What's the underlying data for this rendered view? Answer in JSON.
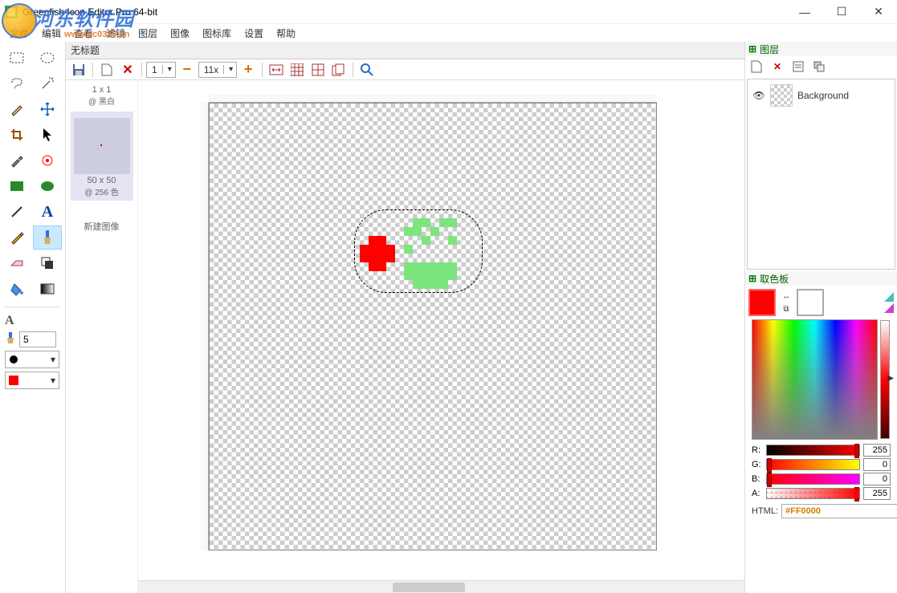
{
  "window": {
    "title": "Greenfish Icon Editor Pro 64-bit",
    "minimize": "—",
    "maximize": "☐",
    "close": "✕"
  },
  "menu": {
    "file": "文件",
    "edit": "编辑",
    "view": "查看",
    "filter": "滤镜",
    "layer": "图层",
    "image": "图像",
    "library": "图标库",
    "settings": "设置",
    "help": "帮助"
  },
  "doc_tab": "无标题",
  "toolbar": {
    "page_num": "1",
    "zoom": "11x"
  },
  "preview": {
    "size1": "1 x 1",
    "mode1": "@ 黑白",
    "size2": "50 x 50",
    "mode2": "@ 256 色",
    "new_image": "新建图像"
  },
  "brush_size": "5",
  "layers_panel": {
    "title": "图层",
    "layer0": "Background"
  },
  "palette_panel": {
    "title": "取色板"
  },
  "colors": {
    "fg": "#FF0000",
    "bg": "#FFFFFF"
  },
  "rgba": {
    "r_label": "R:",
    "r": "255",
    "g_label": "G:",
    "g": "0",
    "b_label": "B:",
    "b": "0",
    "a_label": "A:",
    "a": "255"
  },
  "html_label": "HTML:",
  "html_value": "#FF0000",
  "watermark": {
    "text": "河东软件园",
    "url": "www.pc0359.cn"
  }
}
